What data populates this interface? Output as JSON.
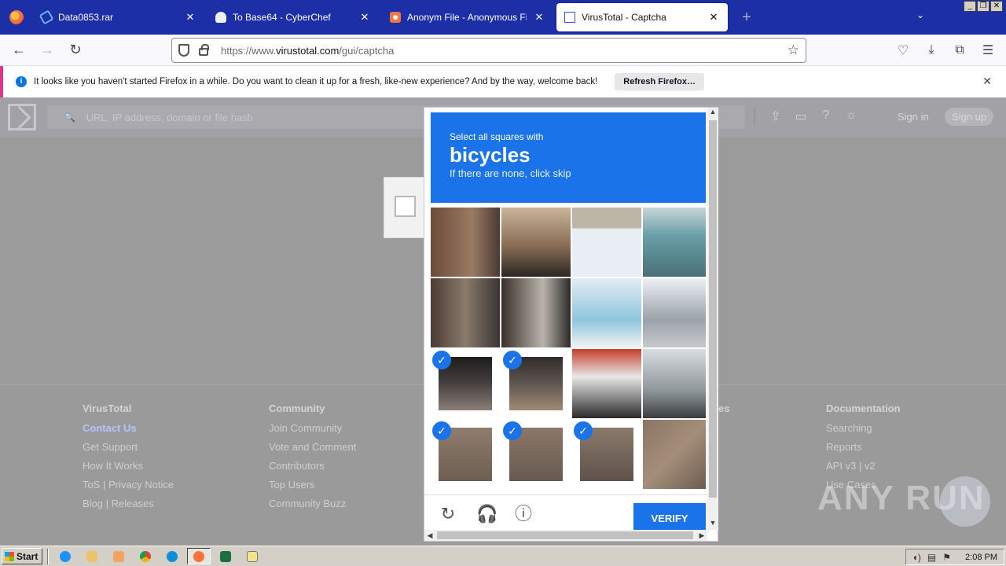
{
  "window_controls": [
    "_",
    "❐",
    "✕"
  ],
  "tabs": [
    {
      "title": "Data0853.rar",
      "icon": "rar-icon",
      "active": false
    },
    {
      "title": "To Base64 - CyberChef",
      "icon": "chef-icon",
      "active": false
    },
    {
      "title": "Anonym File - Anonymous File Uplo",
      "icon": "anonfile-icon",
      "active": false
    },
    {
      "title": "VirusTotal - Captcha",
      "icon": "virustotal-icon",
      "active": true
    }
  ],
  "tab_close": "✕",
  "new_tab": "+",
  "tab_list_icon": "⌄",
  "nav": {
    "back": "←",
    "forward": "→",
    "reload": "↻"
  },
  "url": {
    "proto": "https://www.",
    "host": "virustotal.com",
    "path": "/gui/captcha"
  },
  "toolbar_icons": {
    "star": "☆",
    "pocket": "♡",
    "download": "⤓",
    "extensions": "⧉",
    "menu": "☰"
  },
  "notification": {
    "info": "i",
    "text": "It looks like you haven't started Firefox in a while. Do you want to clean it up for a fresh, like-new experience? And by the way, welcome back!",
    "button": "Refresh Firefox…",
    "close": "✕"
  },
  "vt": {
    "search_placeholder": "URL, IP address, domain or file hash",
    "search_icon": "🔍",
    "header_icons": {
      "upload": "⇪",
      "chat": "▭",
      "help": "?",
      "theme": "☼"
    },
    "sign_in": "Sign in",
    "sign_up": "Sign up"
  },
  "footer": {
    "columns": [
      {
        "heading": "VirusTotal",
        "items": [
          "Contact Us",
          "Get Support",
          "How It Works",
          "ToS | Privacy Notice",
          "Blog | Releases"
        ]
      },
      {
        "heading": "Community",
        "items": [
          "Join Community",
          "Vote and Comment",
          "Contributors",
          "Top Users",
          "Community Buzz"
        ]
      },
      {
        "heading": "es",
        "items": []
      },
      {
        "heading": "Documentation",
        "items": [
          "Searching",
          "Reports",
          "API v3 | v2",
          "Use Cases"
        ]
      }
    ]
  },
  "captcha": {
    "instruction": "Select all squares with",
    "target": "bicycles",
    "hint": "If there are none, click skip",
    "verify": "VERIFY",
    "reload_icon": "↻",
    "audio_icon": "🎧",
    "info_icon": "ⓘ",
    "check_mark": "✓",
    "scroll_up": "▲",
    "scroll_down": "▼",
    "scroll_left": "◀",
    "scroll_right": "▶",
    "selected": [
      8,
      9,
      12,
      13,
      14
    ]
  },
  "watermark": "ANY RUN",
  "taskbar": {
    "start": "Start",
    "clock": "2:08 PM"
  }
}
